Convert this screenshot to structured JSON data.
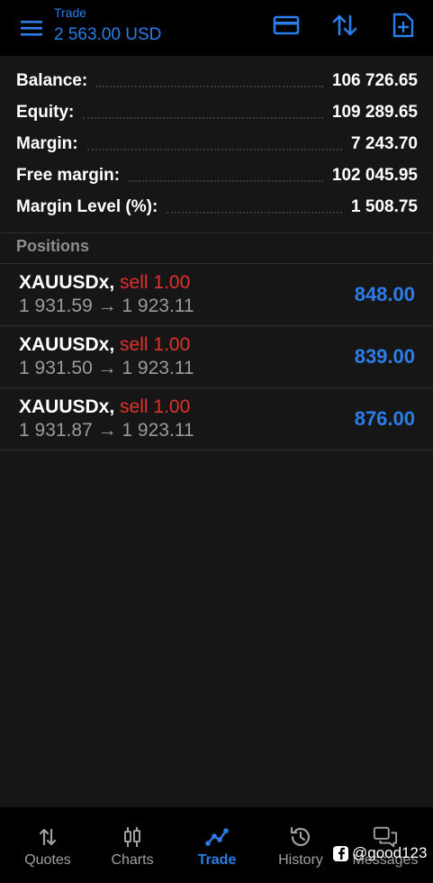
{
  "header": {
    "title": "Trade",
    "subtitle": "2 563.00 USD",
    "accent_color": "#2b7de9",
    "icons": [
      "menu-icon",
      "card-icon",
      "sort-icon",
      "new-order-icon"
    ]
  },
  "summary": {
    "rows": [
      {
        "label": "Balance:",
        "value": "106 726.65"
      },
      {
        "label": "Equity:",
        "value": "109 289.65"
      },
      {
        "label": "Margin:",
        "value": "7 243.70"
      },
      {
        "label": "Free margin:",
        "value": "102 045.95"
      },
      {
        "label": "Margin Level (%):",
        "value": "1 508.75"
      }
    ]
  },
  "positions": {
    "title": "Positions",
    "items": [
      {
        "symbol": "XAUUSDx,",
        "side": "sell 1.00",
        "prices": "1 931.59 → 1 923.11",
        "profit": "848.00"
      },
      {
        "symbol": "XAUUSDx,",
        "side": "sell 1.00",
        "prices": "1 931.50 → 1 923.11",
        "profit": "839.00"
      },
      {
        "symbol": "XAUUSDx,",
        "side": "sell 1.00",
        "prices": "1 931.87 → 1 923.11",
        "profit": "876.00"
      }
    ],
    "sell_color": "#e0312e",
    "profit_color": "#2b7de9"
  },
  "bottom_nav": {
    "items": [
      {
        "label": "Quotes",
        "icon": "quotes-icon"
      },
      {
        "label": "Charts",
        "icon": "charts-icon"
      },
      {
        "label": "Trade",
        "icon": "trade-icon",
        "active": true
      },
      {
        "label": "History",
        "icon": "history-icon"
      },
      {
        "label": "Messages",
        "icon": "messages-icon"
      }
    ]
  },
  "watermark": {
    "text": "@good123",
    "icon": "facebook-icon"
  }
}
